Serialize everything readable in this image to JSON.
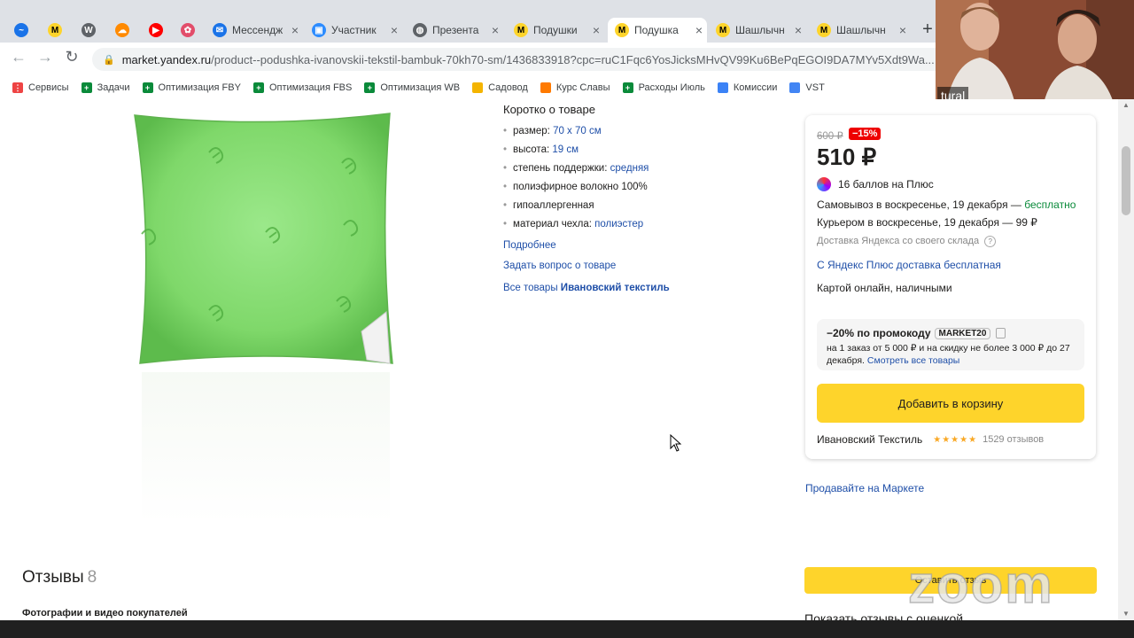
{
  "browser": {
    "tabs": [
      {
        "title": "",
        "icon": "edge-like-icon"
      },
      {
        "title": "",
        "icon": "yandex-market-icon"
      },
      {
        "title": "",
        "icon": "w-icon"
      },
      {
        "title": "",
        "icon": "cloud-icon"
      },
      {
        "title": "",
        "icon": "youtube-icon"
      },
      {
        "title": "",
        "icon": "chrome-ext-icon"
      },
      {
        "title": "Мессендж",
        "icon": "messenger-icon"
      },
      {
        "title": "Участник",
        "icon": "zoom-icon"
      },
      {
        "title": "Презента",
        "icon": "globe-icon"
      },
      {
        "title": "Подушки",
        "icon": "yandex-market-icon"
      },
      {
        "title": "Подушка",
        "icon": "yandex-market-icon"
      },
      {
        "title": "Шашлычн",
        "icon": "yandex-market-icon"
      },
      {
        "title": "Шашлычн",
        "icon": "yandex-market-icon"
      }
    ],
    "url_host": "market.yandex.ru",
    "url_rest": "/product--podushka-ivanovskii-tekstil-bambuk-70kh70-sm/1436833918?cpc=ruC1Fqc6YosJicksMHvQV99Ku6BePqEGOI9DA7MYv5Xdt9Wa...",
    "bookmarks": [
      {
        "label": "Сервисы"
      },
      {
        "label": "Задачи"
      },
      {
        "label": "Оптимизация FBY"
      },
      {
        "label": "Оптимизация FBS"
      },
      {
        "label": "Оптимизация WB"
      },
      {
        "label": "Садовод"
      },
      {
        "label": "Курс Славы"
      },
      {
        "label": "Расходы Июль"
      },
      {
        "label": "Комиссии"
      },
      {
        "label": "VST"
      }
    ]
  },
  "video": {
    "name": "tural"
  },
  "product": {
    "short_title": "Коротко о товаре",
    "specs": [
      {
        "label": "размер:",
        "value": "70 x 70 см"
      },
      {
        "label": "высота:",
        "value": "19 см"
      },
      {
        "label": "степень поддержки:",
        "value": "средняя"
      },
      {
        "label": "полиэфирное волокно 100%",
        "value": ""
      },
      {
        "label": "гипоаллергенная",
        "value": ""
      },
      {
        "label": "материал чехла:",
        "value": "полиэстер"
      }
    ],
    "more_link": "Подробнее",
    "ask_link": "Задать вопрос о товаре",
    "all_goods_prefix": "Все товары",
    "all_goods_brand": "Ивановский текстиль"
  },
  "offer": {
    "old_price": "600 ₽",
    "discount": "−15%",
    "price": "510 ₽",
    "plus_points": "16 баллов на Плюс",
    "pickup": "Самовывоз в воскресенье, 19 декабря — ",
    "pickup_free": "бесплатно",
    "courier": "Курьером в воскресенье, 19 декабря — 99 ₽",
    "yandex_delivery": "Доставка Яндекса со своего склада",
    "plus_delivery": "С Яндекс Плюс доставка бесплатная",
    "payment": "Картой онлайн, наличными",
    "promo_title": "−20% по промокоду",
    "promo_code": "MARKET20",
    "promo_desc": "на 1 заказ от 5 000 ₽ и на скидку не более 3 000 ₽ до 27 декабря.",
    "promo_link": "Смотреть все товары",
    "add_to_cart": "Добавить в корзину",
    "seller": "Ивановский Текстиль",
    "rating_stars": "★★★★★",
    "rating_count": "1529 отзывов",
    "sell_on_market": "Продавайте на Маркете"
  },
  "reviews": {
    "title": "Отзывы",
    "count": "8",
    "photos_title": "Фотографии и видео покупателей",
    "leave_review": "Оставить отзыв",
    "show_by_rating": "Показать отзывы с оценкой"
  },
  "overlay": {
    "zoom_watermark": "zoom"
  },
  "colors": {
    "accent_yellow": "#fed42b",
    "link_blue": "#1f4fa8",
    "discount_red": "#e00000",
    "free_green": "#0a8a3a"
  }
}
